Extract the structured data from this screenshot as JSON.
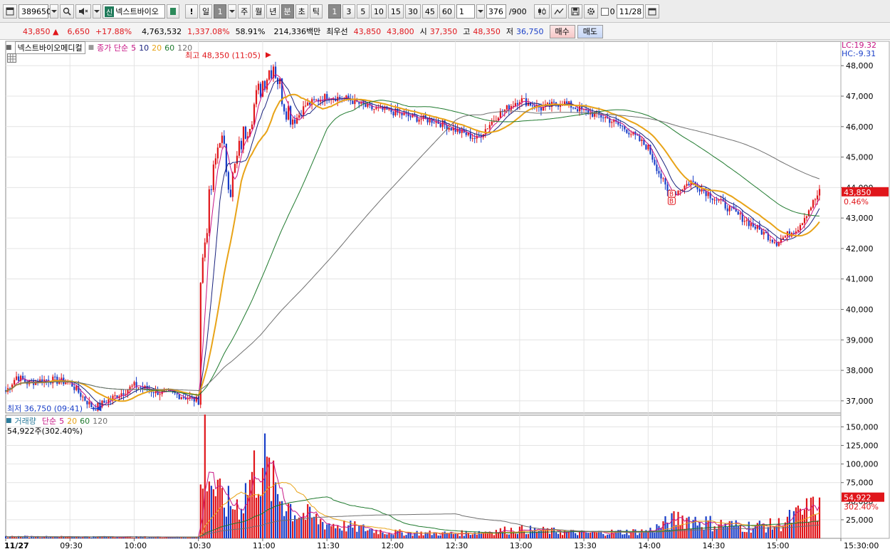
{
  "toolbar": {
    "code": "389650",
    "badge": "신",
    "name": "넥스트바이오",
    "alert": "!",
    "period_buttons": [
      "일",
      "1",
      "주",
      "월",
      "년",
      "분",
      "초",
      "틱"
    ],
    "interval_buttons": [
      "1",
      "3",
      "5",
      "10",
      "15",
      "30",
      "45",
      "60"
    ],
    "count_value": "1",
    "bars_shown": "376",
    "bars_total": "/900",
    "check_label": "0",
    "date_value": "11/28"
  },
  "infobar": {
    "price": "43,850",
    "change": "6,650",
    "change_pct": "+17.88%",
    "volume": "4,763,532",
    "volume_ratio": "1,337.08%",
    "turnover_ratio": "58.91%",
    "amount": "214,336백만",
    "best_label": "최우선",
    "ask": "43,850",
    "bid": "43,800",
    "open_label": "시",
    "open": "37,350",
    "high_label": "고",
    "high": "48,350",
    "low_label": "저",
    "low": "36,750",
    "buy_button": "매수",
    "sell_button": "매도"
  },
  "price_panel": {
    "legend_name": "넥스트바이오메디컬",
    "legend_ma_label": "종가 단순",
    "legend_periods": [
      "5",
      "10",
      "20",
      "60",
      "120"
    ],
    "lc": "LC:19.32",
    "hc": "HC:-9.31",
    "high_marker": "최고 48,350 (11:05)",
    "low_marker": "최저 36,750 (09:41)",
    "current_price_label": "43,850",
    "current_pct_label": "0.46%"
  },
  "volume_panel": {
    "legend_name": "거래량",
    "legend_ma_label": "단순",
    "legend_periods": [
      "5",
      "20",
      "60",
      "120"
    ],
    "value_text": "54,922주(302.40%)",
    "current_label": "54,922",
    "current_pct_label": "302.40%"
  },
  "colors": {
    "up": "#e0161b",
    "down": "#1a3fc8",
    "ma5": "#c71585",
    "ma10": "#1a237e",
    "ma20": "#e8a317",
    "ma60": "#1f7a2e",
    "ma120": "#707070"
  },
  "chart_data": [
    {
      "type": "candlestick",
      "title": "넥스트바이오메디컬",
      "x_ticks": [
        "11/27",
        "09:30",
        "10:00",
        "10:30",
        "11:00",
        "11:30",
        "12:00",
        "12:30",
        "13:00",
        "13:30",
        "14:00",
        "14:30",
        "15:00",
        "15:30:00"
      ],
      "y_ticks": [
        "48,000",
        "47,000",
        "46,000",
        "45,000",
        "44,000",
        "43,000",
        "42,000",
        "41,000",
        "40,000",
        "39,000",
        "38,000",
        "37,000"
      ],
      "ylim": [
        36600,
        48800
      ],
      "summary": {
        "open": 37350,
        "high": 48350,
        "low": 36750,
        "close": 43850,
        "high_time": "11:05",
        "low_time": "09:41"
      },
      "close_path": [
        [
          "09:00",
          37300
        ],
        [
          "09:05",
          37800
        ],
        [
          "09:10",
          37600
        ],
        [
          "09:20",
          37700
        ],
        [
          "09:30",
          37600
        ],
        [
          "09:35",
          37200
        ],
        [
          "09:41",
          36750
        ],
        [
          "09:50",
          37100
        ],
        [
          "10:00",
          37500
        ],
        [
          "10:10",
          37300
        ],
        [
          "10:20",
          37200
        ],
        [
          "10:30",
          37000
        ],
        [
          "10:31",
          41000
        ],
        [
          "10:35",
          43500
        ],
        [
          "10:40",
          45800
        ],
        [
          "10:45",
          44000
        ],
        [
          "10:50",
          45500
        ],
        [
          "10:55",
          46500
        ],
        [
          "11:00",
          47500
        ],
        [
          "11:05",
          48100
        ],
        [
          "11:10",
          46800
        ],
        [
          "11:15",
          46200
        ],
        [
          "11:20",
          46700
        ],
        [
          "11:30",
          47000
        ],
        [
          "11:40",
          46900
        ],
        [
          "11:50",
          46600
        ],
        [
          "12:00",
          46500
        ],
        [
          "12:10",
          46300
        ],
        [
          "12:20",
          46200
        ],
        [
          "12:30",
          45900
        ],
        [
          "12:40",
          45600
        ],
        [
          "12:50",
          46400
        ],
        [
          "13:00",
          46900
        ],
        [
          "13:10",
          46600
        ],
        [
          "13:20",
          46800
        ],
        [
          "13:30",
          46500
        ],
        [
          "13:40",
          46300
        ],
        [
          "13:50",
          45900
        ],
        [
          "14:00",
          45300
        ],
        [
          "14:10",
          43700
        ],
        [
          "14:20",
          44200
        ],
        [
          "14:30",
          43700
        ],
        [
          "14:40",
          43200
        ],
        [
          "14:50",
          42700
        ],
        [
          "15:00",
          42200
        ],
        [
          "15:10",
          42700
        ],
        [
          "15:20",
          43850
        ]
      ]
    },
    {
      "type": "bar",
      "title": "거래량",
      "y_ticks": [
        "150,000",
        "125,000",
        "100,000",
        "75,000",
        "50,000",
        "25,000"
      ],
      "ylim": [
        0,
        160000
      ],
      "last_value": 54922,
      "volume_path": [
        [
          "09:00",
          3000
        ],
        [
          "10:30",
          2000
        ],
        [
          "10:31",
          80000
        ],
        [
          "10:33",
          155000
        ],
        [
          "10:36",
          95000
        ],
        [
          "10:40",
          65000
        ],
        [
          "10:45",
          55000
        ],
        [
          "10:50",
          60000
        ],
        [
          "10:55",
          105000
        ],
        [
          "11:00",
          130000
        ],
        [
          "11:05",
          85000
        ],
        [
          "11:15",
          45000
        ],
        [
          "11:30",
          25000
        ],
        [
          "12:00",
          10000
        ],
        [
          "12:30",
          8000
        ],
        [
          "13:00",
          15000
        ],
        [
          "13:30",
          9000
        ],
        [
          "14:00",
          12000
        ],
        [
          "14:15",
          35000
        ],
        [
          "14:30",
          25000
        ],
        [
          "14:45",
          20000
        ],
        [
          "15:00",
          22000
        ],
        [
          "15:20",
          54922
        ]
      ]
    }
  ]
}
